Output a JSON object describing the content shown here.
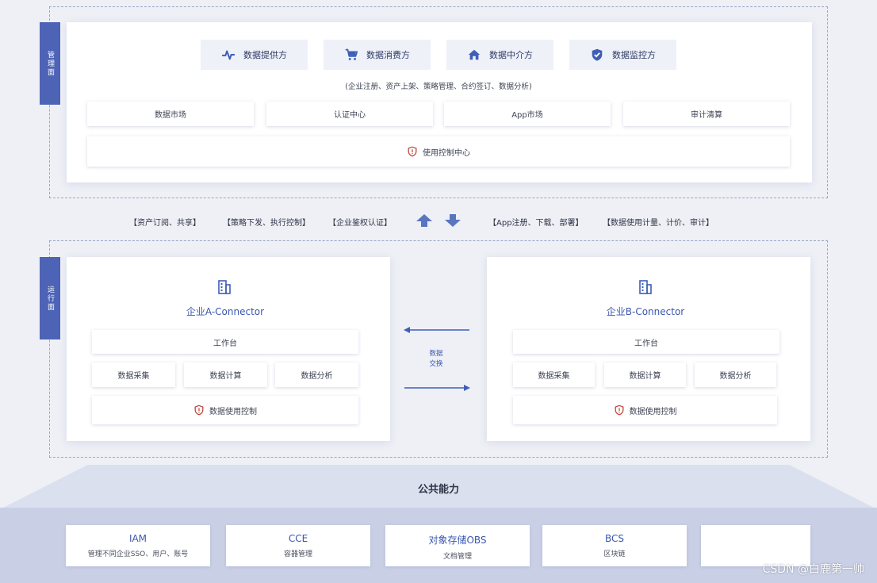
{
  "management": {
    "side_label": "管理面",
    "roles": [
      {
        "label": "数据提供方",
        "icon": "activity-icon"
      },
      {
        "label": "数据消费方",
        "icon": "cart-icon"
      },
      {
        "label": "数据中介方",
        "icon": "home-icon"
      },
      {
        "label": "数据监控方",
        "icon": "shield-check-icon"
      }
    ],
    "subtitle": "(企业注册、资产上架、策略管理、合约签订、数据分析)",
    "modules": [
      "数据市场",
      "认证中心",
      "App市场",
      "审计清算"
    ],
    "control_center": "使用控制中心"
  },
  "middle": {
    "left_items": [
      "【资产订阅、共享】",
      "【策略下发、执行控制】",
      "【企业鉴权认证】"
    ],
    "right_items": [
      "【App注册、下载、部署】",
      "【数据使用计量、计价、审计】"
    ]
  },
  "runtime": {
    "side_label": "运行面",
    "connectors": [
      {
        "title": "企业A-Connector",
        "workbench": "工作台",
        "functions": [
          "数据采集",
          "数据计算",
          "数据分析"
        ],
        "control": "数据使用控制"
      },
      {
        "title": "企业B-Connector",
        "workbench": "工作台",
        "functions": [
          "数据采集",
          "数据计算",
          "数据分析"
        ],
        "control": "数据使用控制"
      }
    ],
    "exchange_line1": "数据",
    "exchange_line2": "交换"
  },
  "public": {
    "title": "公共能力",
    "services": [
      {
        "name": "IAM",
        "desc": "管理不同企业SSO、用户、账号"
      },
      {
        "name": "CCE",
        "desc": "容器管理"
      },
      {
        "name": "对象存储OBS",
        "desc": "文档管理"
      },
      {
        "name": "BCS",
        "desc": "区块链"
      },
      {
        "name": "",
        "desc": ""
      }
    ]
  },
  "watermark": "CSDN @白鹿第一帅",
  "colors": {
    "accent": "#4d63b6",
    "title_blue": "#3b56b0",
    "alert_red": "#c0453c",
    "arrow_blue": "#3f5fb5"
  }
}
